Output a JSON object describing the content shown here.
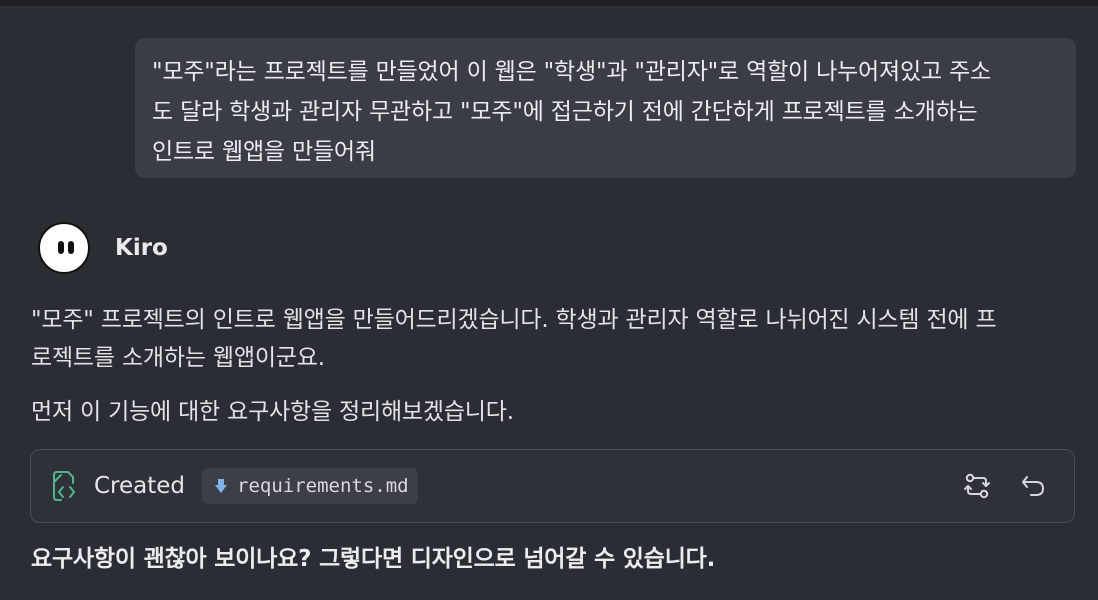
{
  "user_message": {
    "lines": [
      "\"모주\"라는 프로젝트를 만들었어 이 웹은 \"학생\"과 \"관리자\"로 역할이 나누어져있고 주소",
      "도 달라 학생과 관리자 무관하고 \"모주\"에 접근하기 전에 간단하게 프로젝트를 소개하는",
      "인트로 웹앱을 만들어줘"
    ]
  },
  "assistant": {
    "name": "Kiro",
    "avatar_icon": "ghost-face-icon",
    "paragraph1_lines": [
      "\"모주\" 프로젝트의 인트로 웹앱을 만들어드리겠습니다. 학생과 관리자 역할로 나뉘어진 시스템 전에 프",
      "로젝트를 소개하는 웹앱이군요."
    ],
    "paragraph2": "먼저 이 기능에 대한 요구사항을 정리해보겠습니다.",
    "file_card": {
      "status_icon": "file-code-icon",
      "status_label": "Created",
      "file_icon": "download-arrow-icon",
      "file_name": "requirements.md",
      "actions": [
        {
          "name": "compare-icon"
        },
        {
          "name": "undo-icon"
        }
      ]
    },
    "question": "요구사항이 괜찮아 보이나요? 그렇다면 디자인으로 넘어갈 수 있습니다."
  },
  "colors": {
    "background": "#2b2d35",
    "user_bubble": "#3a3c46",
    "card_border": "#4a4c56",
    "file_icon_green": "#4fb58a",
    "download_blue": "#7fb2e6"
  }
}
